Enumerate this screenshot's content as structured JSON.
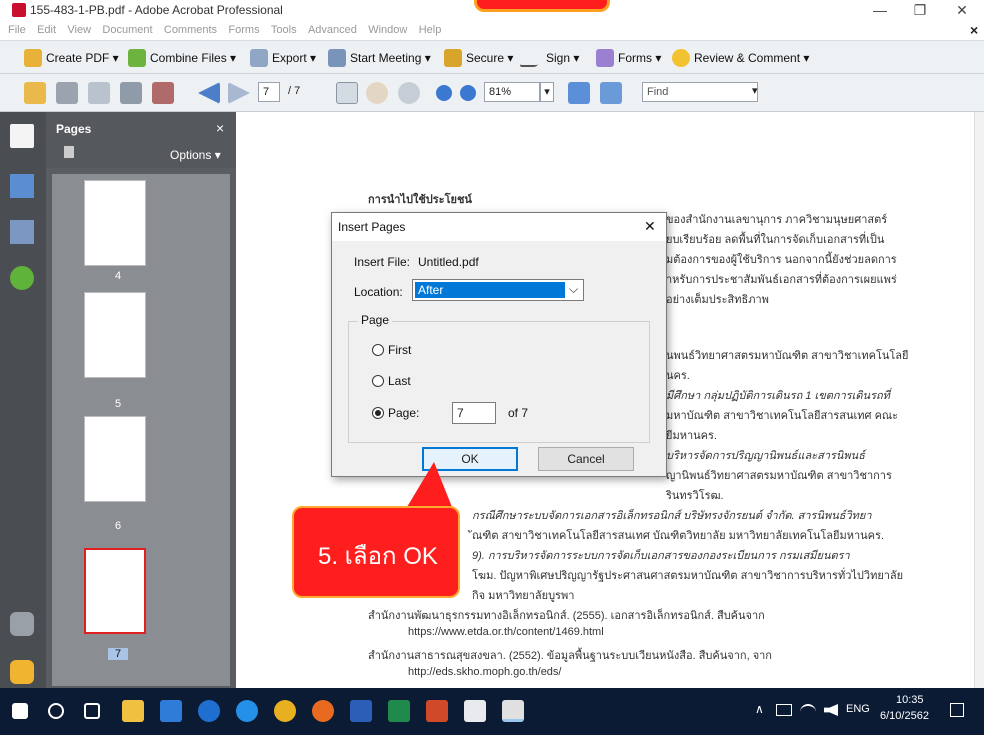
{
  "window": {
    "title": "155-483-1-PB.pdf - Adobe Acrobat Professional",
    "minimize": "—",
    "restore": "❐",
    "close": "✕",
    "menubar_close": "×"
  },
  "menubar": {
    "items": [
      "File",
      "Edit",
      "View",
      "Document",
      "Comments",
      "Forms",
      "Tools",
      "Advanced",
      "Window",
      "Help"
    ]
  },
  "tasks": {
    "create_pdf": "Create PDF ▾",
    "combine_files": "Combine Files ▾",
    "export": "Export ▾",
    "start_meeting": "Start Meeting ▾",
    "secure": "Secure ▾",
    "sign": "Sign ▾",
    "forms": "Forms ▾",
    "review_comment": "Review & Comment ▾"
  },
  "toolbar": {
    "page_current": "7",
    "page_total": "/ 7",
    "zoom": "81%",
    "find_placeholder": "Find",
    "zoom_dd": "▾",
    "find_dd": "▾"
  },
  "pages_panel": {
    "title": "Pages",
    "close": "×",
    "options": "Options ▾",
    "thumbs": [
      "4",
      "5",
      "6",
      "7"
    ]
  },
  "document": {
    "heading": "การนำไปใช้ประโยชน์",
    "lines": [
      "ของสำนักงานเลขานุการ ภาควิชามนุษยศาสตร์",
      "ยบเรียบร้อย ลดพื้นที่ในการจัดเก็บเอกสารที่เป็น",
      "มต้องการของผู้ใช้บริการ นอกจากนี้ยังช่วยลดการ",
      "ำหรับการประชาสัมพันธ์เอกสารที่ต้องการเผยแพร่",
      "อย่างเต็มประสิทธิภาพ",
      "นพนธ์วิทยาศาสตรมหาบัณฑิต สาขาวิชาเทคโนโลยี",
      "นคร.",
      "มีศึกษา กลุ่มปฏิบัติการเดินรถ 1 เขตการเดินรถที่",
      "มหาบัณฑิต สาขาวิชาเทคโนโลยีสารสนเทศ คณะ",
      "ยีมหานคร.",
      "บริหารจัดการปริญญานิพนธ์และสารนิพนธ์",
      "ญานิพนธ์วิทยาศาสตรมหาบัณฑิต สาขาวิชาการ",
      "รินทรวิโรฒ.",
      "กรณีศึกษาระบบจัดการเอกสารอิเล็กทรอนิกส์ บริษัทรงจักรยนต์ จำกัด. สารนิพนธ์วิทยา",
      "ัณฑิต สาขาวิชาเทคโนโลยีสารสนเทศ บัณฑิตวิทยาลัย มหาวิทยาลัยเทคโนโลยีมหานคร.",
      "9). การบริหารจัดการระบบการจัดเก็บเอกสารของกองระเบียนการ กรมเสมียนตรา",
      "โฆม. ปัญหาพิเศษปริญญารัฐประศาสนศาสตรมหาบัณฑิต สาขาวิชาการบริหารทั่วไปวิทยาลัย",
      "กิจ มหาวิทยาลัยบูรพา",
      "สำนักงานพัฒนาธุรกรรมทางอิเล็กทรอนิกส์. (2555). เอกสารอิเล็กทรอนิกส์. สืบค้นจาก",
      "https://www.etda.or.th/content/1469.html",
      "สำนักงานสาธารณสุขสงขลา. (2552). ข้อมูลพื้นฐานระบบเวียนหนังสือ. สืบค้นจาก, จาก",
      "http://eds.skho.moph.go.th/eds/"
    ]
  },
  "dialog": {
    "title": "Insert Pages",
    "close": "✕",
    "insert_file_label": "Insert File:",
    "insert_file_value": "Untitled.pdf",
    "location_label": "Location:",
    "location_value": "After",
    "page_group": "Page",
    "opt_first": "First",
    "opt_last": "Last",
    "opt_page": "Page:",
    "page_value": "7",
    "of_total": "of 7",
    "ok": "OK",
    "cancel": "Cancel",
    "dropdown_arrow": "⌵"
  },
  "callout": {
    "text": "5. เลือก OK"
  },
  "taskbar": {
    "time": "10:35",
    "date": "6/10/2562",
    "lang": "ENG",
    "tray_arrow": "∧"
  },
  "colors": {
    "accent": "#0078d7",
    "callout": "#ff1e1e"
  }
}
